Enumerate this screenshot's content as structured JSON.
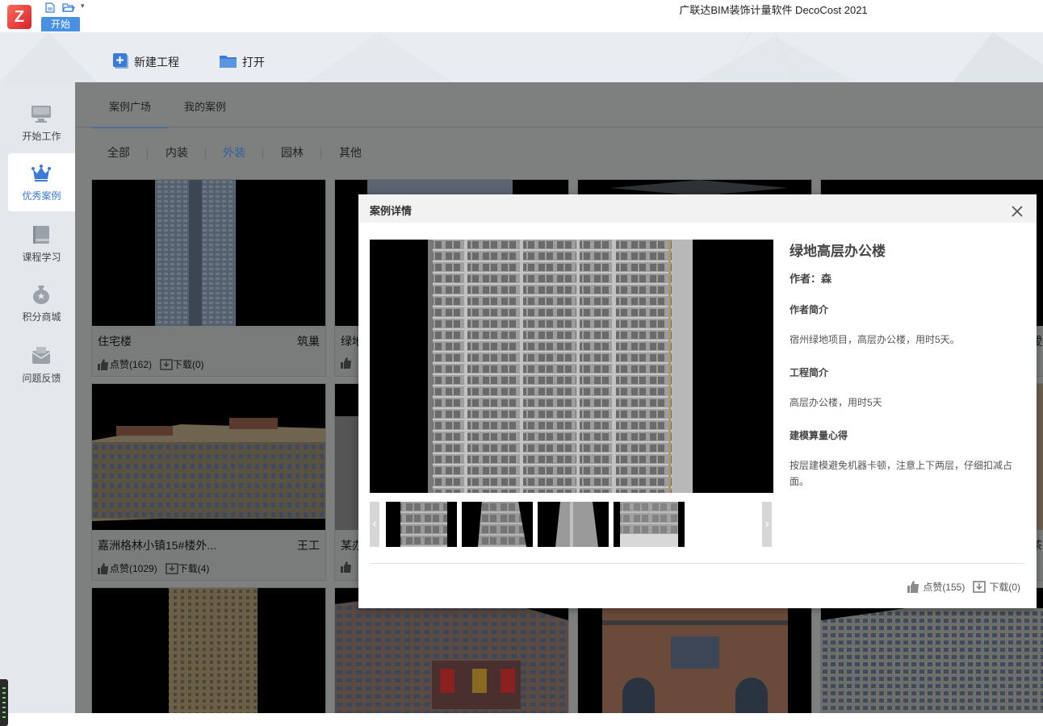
{
  "app": {
    "window_title": "广联达BIM装饰计量软件 DecoCost 2021",
    "logo_letter": "Z",
    "ribbon_tab": "开始"
  },
  "toolbar": {
    "new_project": "新建工程",
    "open": "打开"
  },
  "sidebar": {
    "items": [
      {
        "label": "开始工作",
        "icon": "monitor-icon"
      },
      {
        "label": "优秀案例",
        "icon": "crown-icon",
        "active": true
      },
      {
        "label": "课程学习",
        "icon": "book-icon"
      },
      {
        "label": "积分商城",
        "icon": "money-bag-icon"
      },
      {
        "label": "问题反馈",
        "icon": "feedback-envelope-icon"
      }
    ]
  },
  "main": {
    "tabs": [
      "案例广场",
      "我的案例"
    ],
    "active_tab": "案例广场",
    "filters": [
      "全部",
      "内装",
      "外装",
      "园林",
      "其他"
    ],
    "active_filter": "外装",
    "cards": [
      {
        "title": "住宅楼",
        "author": "筑巢",
        "likes": "点赞(162)",
        "downloads": "下载(0)"
      },
      {
        "title": "绿地",
        "author": "",
        "likes": "",
        "downloads": ""
      },
      {
        "title": "",
        "author": "",
        "likes": "",
        "downloads": ""
      },
      {
        "title": "",
        "author": "僾",
        "likes": "",
        "downloads": ""
      },
      {
        "title": "嘉洲格林小镇15#楼外...",
        "author": "王工",
        "likes": "点赞(1029)",
        "downloads": "下载(4)"
      },
      {
        "title": "某办",
        "author": "",
        "likes": "",
        "downloads": ""
      },
      {
        "title": "",
        "author": "",
        "likes": "",
        "downloads": ""
      },
      {
        "title": "",
        "author": "茶",
        "likes": "",
        "downloads": ""
      }
    ]
  },
  "modal": {
    "title": "案例详情",
    "case_title": "绿地高层办公楼",
    "author": "作者：森",
    "author_intro_heading": "作者简介",
    "author_intro": "宿州绿地项目，高层办公楼，用时5天。",
    "project_intro_heading": "工程简介",
    "project_intro": "高层办公楼，用时5天",
    "experience_heading": "建模算量心得",
    "experience": "按层建模避免机器卡顿，注意上下两层，仔细扣减占面。",
    "likes": "点赞(155)",
    "downloads": "下载(0)",
    "prev_arrow": "‹",
    "next_arrow": "›"
  },
  "colors": {
    "accent": "#4a90e2",
    "active_text": "#3a7bd5",
    "overlay": "#7e8080"
  }
}
